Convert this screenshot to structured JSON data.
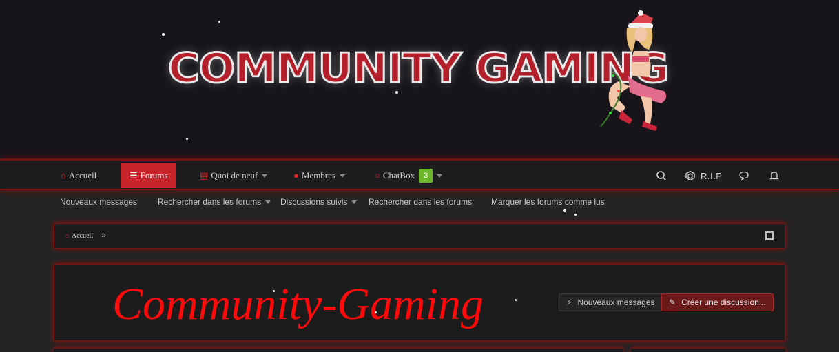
{
  "banner": {
    "logo_text": "COMMUNITY GAMING",
    "logo_image": "santa-pinup-girl-illustration"
  },
  "nav": {
    "items": [
      {
        "label": "Accueil",
        "icon": "home-icon"
      },
      {
        "label": "Forums",
        "icon": "list-icon",
        "active": true
      },
      {
        "label": "Quoi de neuf",
        "icon": "newspaper-icon"
      },
      {
        "label": "Membres",
        "icon": "users-icon"
      },
      {
        "label": "ChatBox",
        "icon": "comments-icon",
        "badge": "3"
      }
    ],
    "right": {
      "search_icon": "search-icon",
      "rip_label": "R.I.P",
      "messages_icon": "chat-bubble-icon",
      "alerts_icon": "bell-icon"
    }
  },
  "subnav": {
    "items": [
      {
        "label": "Nouveaux messages"
      },
      {
        "label": "Rechercher dans les forums",
        "dropdown": true
      },
      {
        "label": "Discussions suivis",
        "dropdown": true
      },
      {
        "label": "Rechercher dans les forums"
      },
      {
        "label": "Marquer les forums comme lus"
      }
    ]
  },
  "breadcrumb": {
    "home_label": "Accueil",
    "separator": "»"
  },
  "title": {
    "text": "Community-Gaming",
    "new_posts_button": "Nouveaux messages",
    "create_thread_button": "Créer une discussion..."
  },
  "colors": {
    "accent": "#c9242b",
    "title_red": "#ff0a0a",
    "badge_green": "#6cb52a",
    "background": "#242424"
  }
}
